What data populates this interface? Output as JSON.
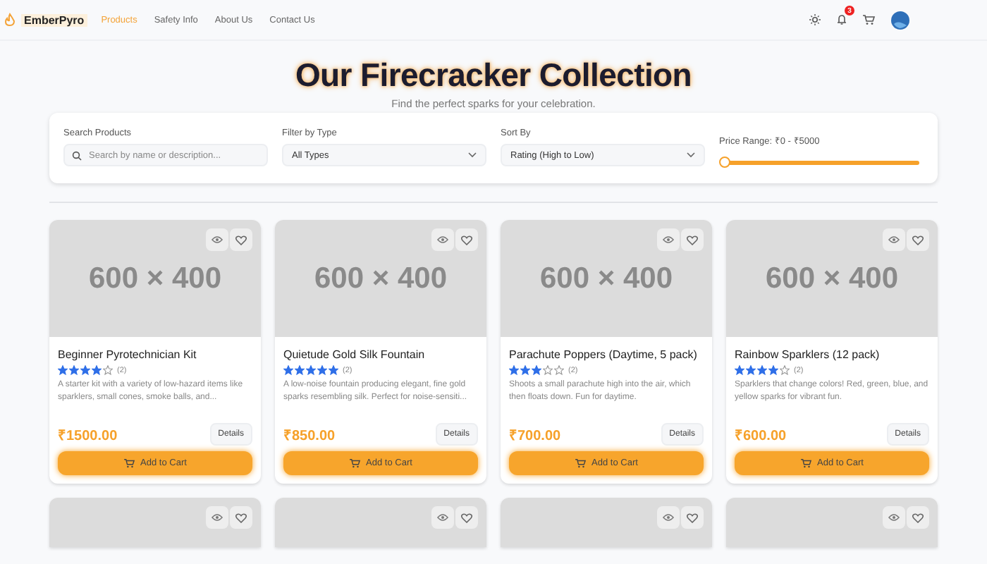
{
  "nav": {
    "brand": "EmberPyro",
    "links": [
      {
        "label": "Products",
        "selected": true
      },
      {
        "label": "Safety Info",
        "selected": false
      },
      {
        "label": "About Us",
        "selected": false
      },
      {
        "label": "Contact Us",
        "selected": false
      }
    ],
    "notification_count": "3"
  },
  "header": {
    "title": "Our Firecracker Collection",
    "subtitle": "Find the perfect sparks for your celebration."
  },
  "filters": {
    "search": {
      "label": "Search Products",
      "placeholder": "Search by name or description..."
    },
    "type": {
      "label": "Filter by Type",
      "value": "All Types"
    },
    "sort": {
      "label": "Sort By",
      "value": "Rating (High to Low)"
    },
    "price": {
      "label": "Price Range: ₹0 - ₹5000",
      "level": 0
    }
  },
  "products": [
    {
      "image_label": "600 × 400",
      "name": "Beginner Pyrotechnician Kit",
      "stars": 4,
      "reviews": "(2)",
      "description": "A starter kit with a variety of low-hazard items like sparklers, small cones, smoke balls, and...",
      "price": "₹1500.00",
      "details": "Details",
      "cart": "Add to Cart"
    },
    {
      "image_label": "600 × 400",
      "name": "Quietude Gold Silk Fountain",
      "stars": 5,
      "reviews": "(2)",
      "description": "A low-noise fountain producing elegant, fine gold sparks resembling silk. Perfect for noise-sensiti...",
      "price": "₹850.00",
      "details": "Details",
      "cart": "Add to Cart"
    },
    {
      "image_label": "600 × 400",
      "name": "Parachute Poppers (Daytime, 5 pack)",
      "stars": 3,
      "reviews": "(2)",
      "description": "Shoots a small parachute high into the air, which then floats down. Fun for daytime.",
      "price": "₹700.00",
      "details": "Details",
      "cart": "Add to Cart"
    },
    {
      "image_label": "600 × 400",
      "name": "Rainbow Sparklers (12 pack)",
      "stars": 4,
      "reviews": "(2)",
      "description": "Sparklers that change colors! Red, green, blue, and yellow sparks for vibrant fun.",
      "price": "₹600.00",
      "details": "Details",
      "cart": "Add to Cart"
    }
  ],
  "more_products": [
    {
      "kind": "placeholder"
    },
    {
      "kind": "placeholder"
    },
    {
      "kind": "placeholder"
    },
    {
      "kind": "placeholder"
    }
  ]
}
